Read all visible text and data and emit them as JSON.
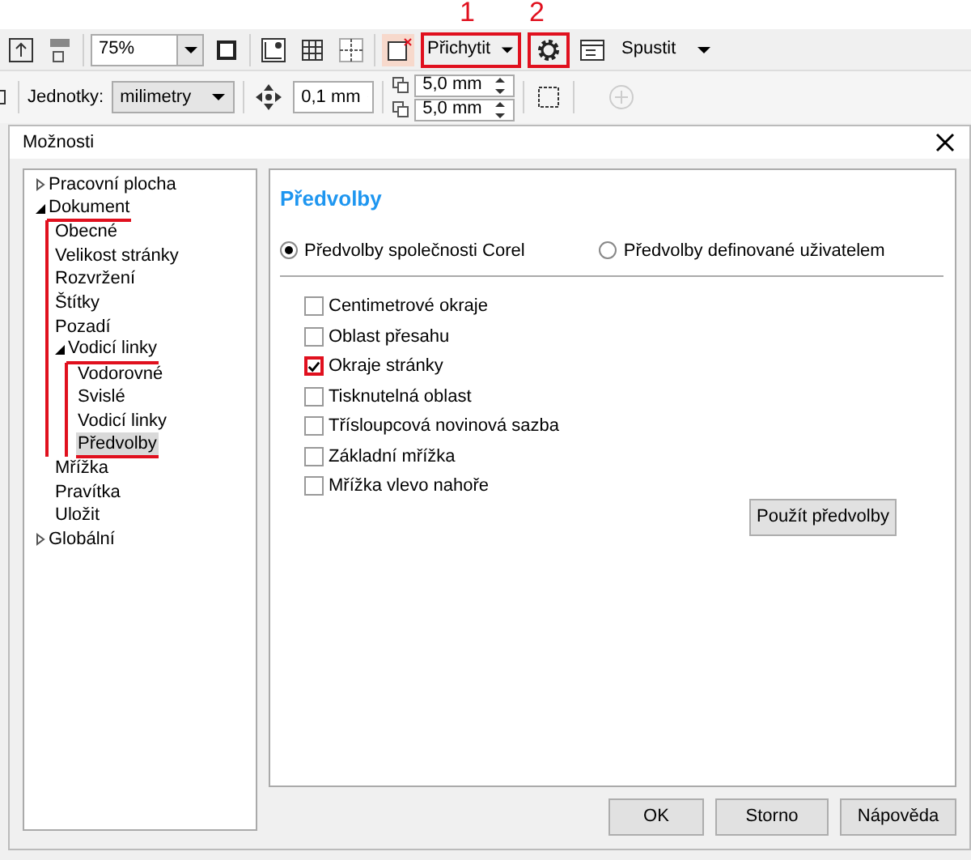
{
  "toolbar": {
    "zoom": "75%",
    "snap": {
      "label": "Přichytit",
      "highlighted": true,
      "callout": "1"
    },
    "settings": {
      "highlighted": true,
      "callout": "2"
    },
    "run": "Spustit"
  },
  "property_bar": {
    "units_label": "Jednotky:",
    "units": "milimetry",
    "nudge": "0,1 mm",
    "duplicate_x": "5,0 mm",
    "duplicate_y": "5,0 mm"
  },
  "dialog": {
    "title": "Možnosti",
    "tree": [
      {
        "label": "Pracovní plocha",
        "expanded": false,
        "selected": false,
        "highlighted": false
      },
      {
        "label": "Dokument",
        "expanded": true,
        "selected": false,
        "highlighted": true,
        "children": [
          {
            "label": "Obecné",
            "selected": false,
            "highlighted": false
          },
          {
            "label": "Velikost stránky",
            "selected": false,
            "highlighted": false
          },
          {
            "label": "Rozvržení",
            "selected": false,
            "highlighted": false
          },
          {
            "label": "Štítky",
            "selected": false,
            "highlighted": false
          },
          {
            "label": "Pozadí",
            "selected": false,
            "highlighted": false
          },
          {
            "label": "Vodicí linky",
            "expanded": true,
            "selected": false,
            "highlighted": true,
            "children": [
              {
                "label": "Vodorovné",
                "selected": false,
                "highlighted": false
              },
              {
                "label": "Svislé",
                "selected": false,
                "highlighted": false
              },
              {
                "label": "Vodicí linky",
                "selected": false,
                "highlighted": false
              },
              {
                "label": "Předvolby",
                "selected": true,
                "highlighted": true
              }
            ]
          },
          {
            "label": "Mřížka",
            "selected": false,
            "highlighted": false
          },
          {
            "label": "Pravítka",
            "selected": false,
            "highlighted": false
          },
          {
            "label": "Uložit",
            "selected": false,
            "highlighted": false
          }
        ]
      },
      {
        "label": "Globální",
        "expanded": false,
        "selected": false,
        "highlighted": false
      }
    ],
    "heading": "Předvolby",
    "radios": [
      {
        "label": "Předvolby společnosti Corel",
        "selected": true
      },
      {
        "label": "Předvolby definované uživatelem",
        "selected": false
      }
    ],
    "checkboxes": [
      {
        "label": "Centimetrové okraje",
        "checked": false,
        "highlighted": false
      },
      {
        "label": "Oblast přesahu",
        "checked": false,
        "highlighted": false
      },
      {
        "label": "Okraje stránky",
        "checked": true,
        "highlighted": true
      },
      {
        "label": "Tisknutelná oblast",
        "checked": false,
        "highlighted": false
      },
      {
        "label": "Třísloupcová novinová sazba",
        "checked": false,
        "highlighted": false
      },
      {
        "label": "Základní mřížka",
        "checked": false,
        "highlighted": false
      },
      {
        "label": "Mřížka vlevo nahoře",
        "checked": false,
        "highlighted": false
      }
    ],
    "apply_button": "Použít předvolby",
    "buttons": [
      "OK",
      "Storno",
      "Nápověda"
    ]
  }
}
